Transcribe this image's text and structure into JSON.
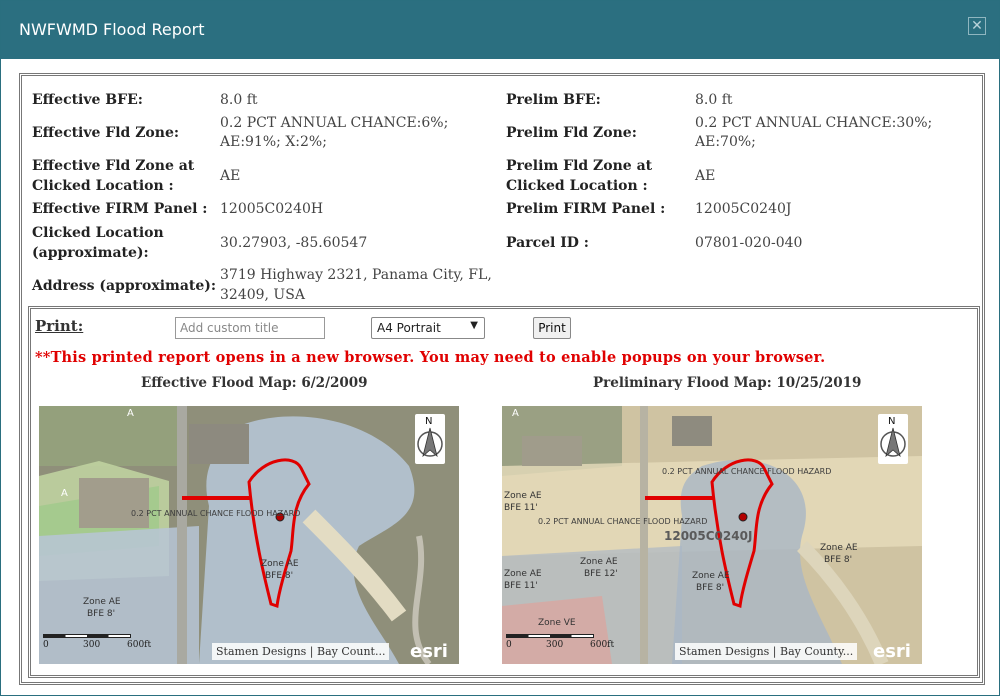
{
  "dialog": {
    "title": "NWFWMD Flood Report",
    "close_icon": "close-icon"
  },
  "info": {
    "effective_bfe_label": "Effective BFE:",
    "effective_bfe_value": "8.0 ft",
    "prelim_bfe_label": "Prelim BFE:",
    "prelim_bfe_value": "8.0 ft",
    "effective_zone_label": "Effective Fld Zone:",
    "effective_zone_value_1": "0.2 PCT ANNUAL CHANCE:6%;",
    "effective_zone_value_2": "AE:91%; X:2%;",
    "prelim_zone_label": "Prelim Fld Zone:",
    "prelim_zone_value_1": "0.2 PCT ANNUAL CHANCE:30%;",
    "prelim_zone_value_2": "AE:70%;",
    "effective_zone_clicked_label_1": "Effective Fld Zone at",
    "effective_zone_clicked_label_2": "Clicked Location :",
    "effective_zone_clicked_value": "AE",
    "prelim_zone_clicked_label_1": "Prelim Fld Zone at",
    "prelim_zone_clicked_label_2": "Clicked Location :",
    "prelim_zone_clicked_value": "AE",
    "effective_panel_label": "Effective FIRM Panel :",
    "effective_panel_value": "12005C0240H",
    "prelim_panel_label": "Prelim FIRM Panel :",
    "prelim_panel_value": "12005C0240J",
    "clicked_location_label_1": "Clicked Location",
    "clicked_location_label_2": "(approximate):",
    "clicked_location_value": "30.27903, -85.60547",
    "parcel_label": "Parcel ID :",
    "parcel_value": "07801-020-040",
    "address_label": "Address (approximate):",
    "address_value_1": "3719 Highway 2321, Panama City, FL,",
    "address_value_2": "32409, USA"
  },
  "print": {
    "label": "Print:",
    "title_placeholder": "Add custom title",
    "layout_selected": "A4 Portrait",
    "print_button": "Print",
    "warning": "**This printed report opens in a new browser. You may need to enable popups on your browser."
  },
  "maps": {
    "effective": {
      "title": "Effective Flood Map: 6/2/2009",
      "attribution": "Stamen Designs | Bay Count...",
      "scale_0": "0",
      "scale_1": "300",
      "scale_2": "600ft",
      "esri": "esri",
      "label_a1": "A",
      "label_a2": "A",
      "label_hazard": "0.2 PCT ANNUAL CHANCE FLOOD HAZARD",
      "label_ae_1": "Zone AE",
      "label_ae_1b": "BFE 8'",
      "label_ae_2": "Zone AE",
      "label_ae_2b": "BFE 8'",
      "north": "N"
    },
    "prelim": {
      "title": "Preliminary Flood Map: 10/25/2019",
      "attribution": "Stamen Designs | Bay County...",
      "scale_0": "0",
      "scale_1": "300",
      "scale_2": "600ft",
      "esri": "esri",
      "label_a1": "A",
      "label_hazard_1": "0.2 PCT ANNUAL CHANCE FLOOD HAZARD",
      "label_hazard_2": "0.2 PCT ANNUAL CHANCE FLOOD HAZARD",
      "label_panel": "12005C0240J",
      "label_ae_1": "Zone AE",
      "label_ae_1b": "BFE 11'",
      "label_ae_2": "Zone AE",
      "label_ae_2b": "BFE 12'",
      "label_ae_3": "Zone AE",
      "label_ae_3b": "BFE 11'",
      "label_ae_4": "Zone AE",
      "label_ae_4b": "BFE 8'",
      "label_ae_5": "Zone AE",
      "label_ae_5b": "BFE 8'",
      "label_ve": "Zone VE",
      "north": "N"
    }
  }
}
